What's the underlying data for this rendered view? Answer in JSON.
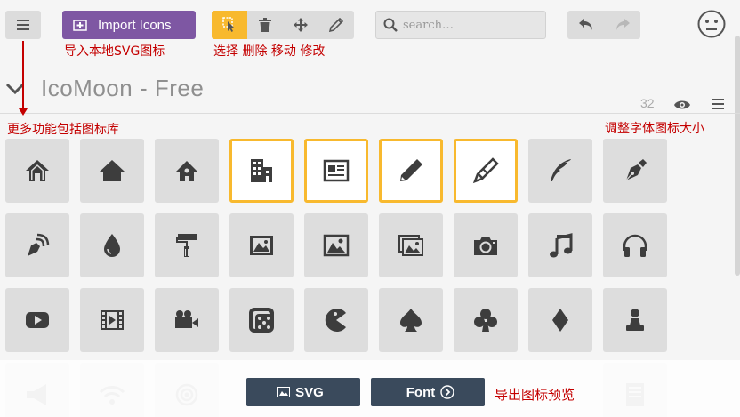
{
  "toolbar": {
    "import_label": "Import Icons",
    "search_placeholder": "search…",
    "tools": [
      "select-icon",
      "delete-icon",
      "move-icon",
      "edit-icon"
    ]
  },
  "annotations": {
    "import": "导入本地SVG图标",
    "tools": "选择 删除 移动 修改",
    "menu": "更多功能包括图标库",
    "size": "调整字体图标大小",
    "export": "导出图标预览"
  },
  "iconset": {
    "title": "IcoMoon - Free",
    "size": "32"
  },
  "icons": [
    [
      "home-icon",
      "home2-icon",
      "home3-icon",
      "office-icon",
      "newspaper-icon",
      "pencil-icon",
      "pencil2-icon",
      "quill-icon",
      "pen-icon"
    ],
    [
      "blog-icon",
      "eyedropper-icon",
      "paint-format-icon",
      "image-icon",
      "images-icon",
      "images2-icon",
      "camera-icon",
      "music-icon",
      "headphones-icon"
    ],
    [
      "play-icon",
      "film-icon",
      "video-camera-icon",
      "dice-icon",
      "pacman-icon",
      "spades-icon",
      "clubs-icon",
      "diamonds-icon",
      "pawn-icon"
    ],
    [
      "bullhorn-icon",
      "connection-icon",
      "podcast-icon",
      "",
      "",
      "",
      "",
      "",
      "profile-icon"
    ]
  ],
  "selected_icons": [
    "office-icon",
    "newspaper-icon",
    "pencil-icon",
    "pencil2-icon"
  ],
  "bottom": {
    "svg_label": "SVG",
    "font_label": "Font"
  },
  "colors": {
    "accent": "#f8b92e",
    "import": "#7e57a3",
    "bottom": "#3a4a5c",
    "annotation": "#c40000"
  }
}
